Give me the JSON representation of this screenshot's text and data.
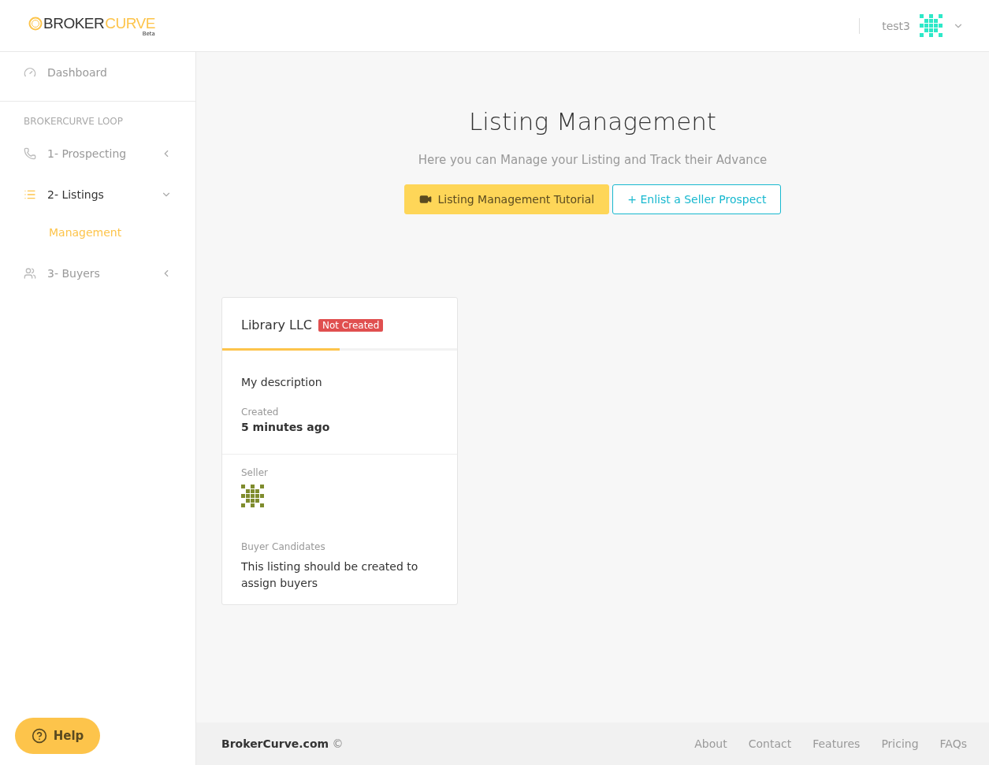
{
  "header": {
    "logo": {
      "left": "BROKER",
      "right": "CURVE",
      "tag": "Beta"
    },
    "user": {
      "name": "test3"
    }
  },
  "sidebar": {
    "items": [
      {
        "kind": "link",
        "label": "Dashboard",
        "selected": false
      },
      {
        "kind": "section",
        "label": "BROKERCURVE LOOP"
      },
      {
        "kind": "group",
        "label": "1- Prospecting",
        "expanded": false,
        "selected": false
      },
      {
        "kind": "group",
        "label": "2- Listings",
        "expanded": true,
        "selected": true,
        "children": [
          {
            "label": "Management",
            "selected": true
          }
        ]
      },
      {
        "kind": "group",
        "label": "3- Buyers",
        "expanded": false,
        "selected": false
      }
    ]
  },
  "page": {
    "title": "Listing Management",
    "subtitle": "Here you can Manage your Listing and Track their Advance",
    "buttons": [
      {
        "kind": "video",
        "label": "Listing Management Tutorial"
      },
      {
        "kind": "add",
        "label": "+ Enlist a Seller Prospect"
      }
    ]
  },
  "listings": [
    {
      "name": "Library LLC",
      "status": "Not Created",
      "created_state": false,
      "level": 0.5,
      "description": "My description",
      "created_label": "Created",
      "created": "5 minutes ago",
      "seller_label": "Seller",
      "buyers_label": "Buyer Candidates",
      "buyers_text": "This listing should be created to assign buyers"
    }
  ],
  "help": {
    "label": "Help"
  },
  "footer": {
    "brand": "**BrokerCurve.com** ©",
    "links": [
      "About",
      "Contact",
      "Features",
      "Pricing",
      "FAQs"
    ]
  }
}
